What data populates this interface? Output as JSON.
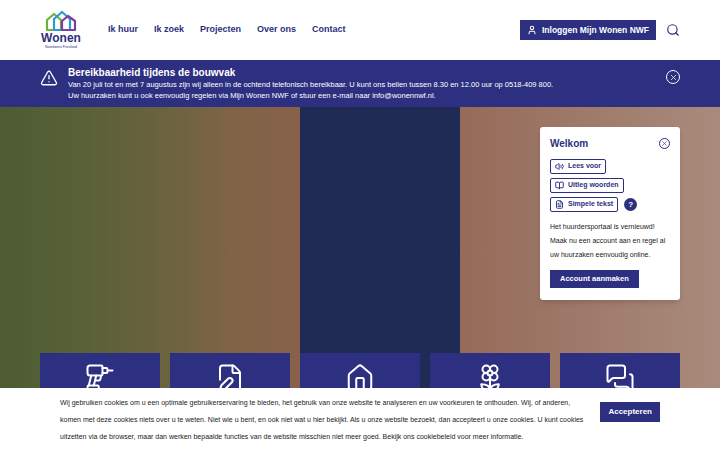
{
  "header": {
    "logo": {
      "name": "Wonen",
      "tagline": "Noordwest Friesland"
    },
    "nav": [
      "Ik huur",
      "Ik zoek",
      "Projecten",
      "Over ons",
      "Contact"
    ],
    "login_button": "Inloggen Mijn Wonen NWF"
  },
  "alert": {
    "title": "Bereikbaarheid tijdens de bouwvak",
    "lines": [
      "Van 20 juli tot en met 7 augustus zijn wij alleen in de ochtend telefonisch bereikbaar. U kunt ons bellen tussen 8.30 en 12.00 uur op 0518-409 800.",
      "Uw huurzaken kunt u ook eenvoudig regelen via Mijn Wonen NWF of stuur een e-mail naar info@wonennwf.nl."
    ]
  },
  "welcome": {
    "title": "Welkom",
    "tools": [
      {
        "label": "Lees voor",
        "kind": "speaker"
      },
      {
        "label": "Uitleg woorden",
        "kind": "book"
      },
      {
        "label": "Simpele tekst",
        "kind": "text"
      }
    ],
    "help": "?",
    "text": "Het huurdersportaal is vernieuwd! Maak nu een account aan en regel al uw huurzaken eenvoudig online.",
    "button": "Account aanmaken"
  },
  "tiles": [
    {
      "kind": "drill"
    },
    {
      "kind": "document"
    },
    {
      "kind": "house"
    },
    {
      "kind": "flower"
    },
    {
      "kind": "chat"
    }
  ],
  "cookie": {
    "text": "Wij gebruiken cookies om u een optimale gebruikerservaring te bieden, het gebruik van onze website te analyseren en uw voorkeuren te onthouden. Wij, of anderen, komen met deze cookies niets over u te weten. Niet wie u bent, en ook niet wat u hier bekijkt. Als u onze website bezoekt, dan accepteert u onze cookies. U kunt cookies uitzetten via de browser, maar dan werken bepaalde functies van de website misschien niet meer goed. Bekijk ons cookiebeleid voor meer informatie.",
    "button": "Accepteren"
  }
}
